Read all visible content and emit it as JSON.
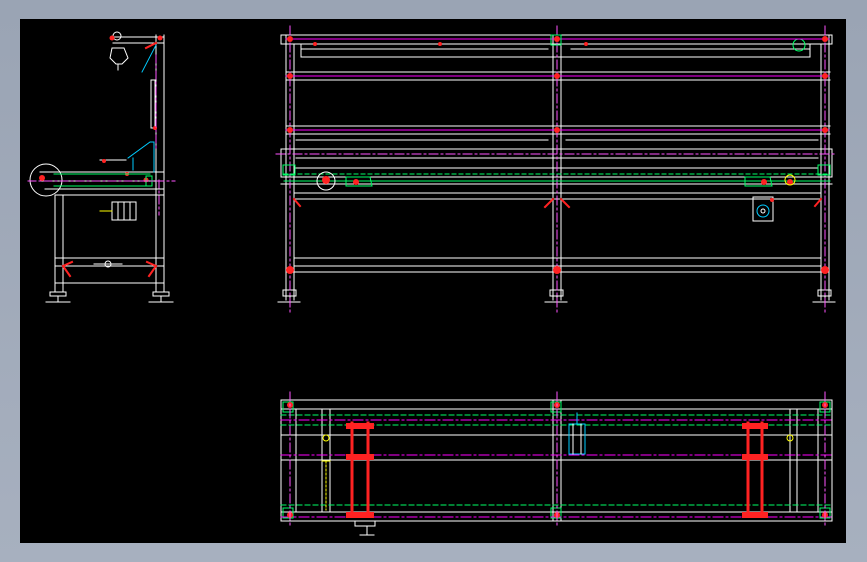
{
  "app": {
    "window_background": "#a7b0bf",
    "canvas_background": "#000000"
  },
  "drawing": {
    "views": [
      "side-view",
      "front-view",
      "top-view"
    ],
    "colors": {
      "outline": "#ffffff",
      "dimension": "#ff00ff",
      "centerline": "#ff55ff",
      "guide": "#00ff66",
      "highlight": "#ff2222",
      "accent": "#ffff00",
      "motor": "#00ccff"
    },
    "labels": []
  }
}
